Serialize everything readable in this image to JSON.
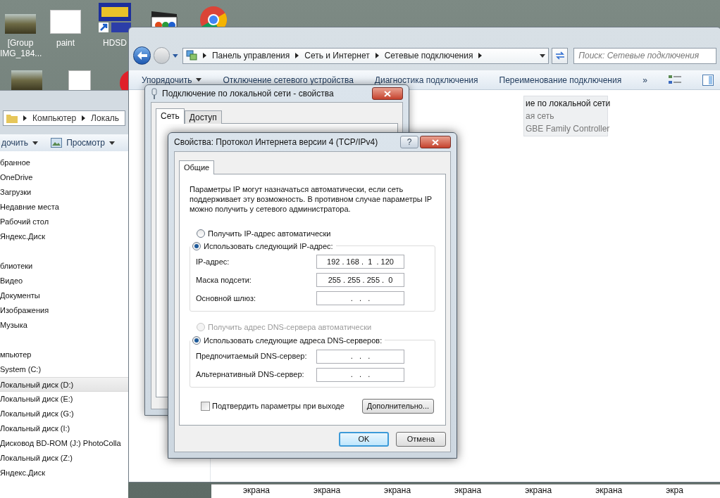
{
  "desktop": {
    "icons": [
      {
        "kind": "photo",
        "label": "[Group IMG_184..."
      },
      {
        "kind": "paint",
        "label": "paint"
      },
      {
        "kind": "shortcut",
        "label": "HDSD"
      },
      {
        "kind": "media"
      },
      {
        "kind": "browser"
      }
    ],
    "icons_row_2": [
      {
        "kind": "photo"
      },
      {
        "kind": "document"
      },
      {
        "kind": "music"
      }
    ]
  },
  "explorer": {
    "breadcrumb": [
      "Компьютер",
      "Локаль"
    ],
    "toolbar": [
      {
        "label": "дочить",
        "dropdown": true,
        "kind": "text"
      },
      {
        "label": "Просмотр",
        "dropdown": true,
        "kind": "view"
      }
    ],
    "nav": [
      {
        "label": "бранное",
        "children": [
          {
            "label": "OneDrive",
            "selected": false
          },
          {
            "label": "Загрузки",
            "selected": false
          },
          {
            "label": "Недавние места",
            "selected": false
          },
          {
            "label": "Рабочий стол",
            "selected": false
          },
          {
            "label": "Яндекс.Диск",
            "selected": false
          }
        ]
      },
      {
        "label": "блиотеки",
        "children": [
          {
            "label": "Видео",
            "selected": false
          },
          {
            "label": "Документы",
            "selected": false
          },
          {
            "label": "Изображения",
            "selected": false
          },
          {
            "label": "Музыка",
            "selected": false
          }
        ]
      },
      {
        "label": "мпьютер",
        "children": [
          {
            "label": "System (C:)",
            "selected": false
          },
          {
            "label": "Локальный диск (D:)",
            "selected": true
          },
          {
            "label": "Локальный диск (E:)",
            "selected": false
          },
          {
            "label": "Локальный диск (G:)",
            "selected": false
          },
          {
            "label": "Локальный диск (I:)",
            "selected": false
          },
          {
            "label": "Дисковод BD-ROM (J:) PhotoColla",
            "selected": false
          },
          {
            "label": "Локальный диск (Z:)",
            "selected": false
          },
          {
            "label": "Яндекс.Диск",
            "selected": false
          }
        ]
      }
    ]
  },
  "network_window": {
    "breadcrumb": [
      "Панель управления",
      "Сеть и Интернет",
      "Сетевые подключения"
    ],
    "search": {
      "placeholder": "Поиск: Сетевые подключения"
    },
    "toolbar": [
      {
        "label": "Упорядочить",
        "dropdown": true
      },
      {
        "label": "Отключение сетевого устройства",
        "dropdown": false
      },
      {
        "label": "Диагностика подключения",
        "dropdown": false
      },
      {
        "label": "Переименование подключения",
        "dropdown": false
      },
      {
        "label": "»",
        "dropdown": false
      }
    ],
    "connection": {
      "name": "ие по локальной сети",
      "status": "ая сеть",
      "device": "GBE Family Controller"
    },
    "bottom_labels": [
      "экрана",
      "экрана",
      "экрана",
      "экрана",
      "экрана",
      "экрана",
      "экра"
    ]
  },
  "connection_dialog": {
    "title": "Подключение по локальной сети - свойства",
    "tabs": [
      {
        "label": "Сеть",
        "selected": true
      },
      {
        "label": "Доступ",
        "selected": false
      }
    ]
  },
  "ipv4_dialog": {
    "title": "Свойства: Протокол Интернета версии 4 (TCP/IPv4)",
    "help": "?",
    "tabs": [
      {
        "label": "Общие",
        "selected": true
      }
    ],
    "description": "Параметры IP могут назначаться автоматически, если сеть поддерживает эту возможность. В противном случае параметры IP можно получить у сетевого администратора.",
    "ip": {
      "auto": {
        "label": "Получить IP-адрес автоматически",
        "selected": false,
        "disabled": false
      },
      "manual": {
        "label": "Использовать следующий IP-адрес:",
        "selected": true,
        "disabled": false
      },
      "fields": [
        {
          "label": "IP-адрес:",
          "value": "192 . 168 .  1  . 120"
        },
        {
          "label": "Маска подсети:",
          "value": "255 . 255 . 255 .  0"
        },
        {
          "label": "Основной шлюз:",
          "value": ".   .   ."
        }
      ]
    },
    "dns": {
      "auto": {
        "label": "Получить адрес DNS-сервера автоматически",
        "selected": false,
        "disabled": true
      },
      "manual": {
        "label": "Использовать следующие адреса DNS-серверов:",
        "selected": true,
        "disabled": false
      },
      "fields": [
        {
          "label": "Предпочитаемый DNS-сервер:",
          "value": ".   .   ."
        },
        {
          "label": "Альтернативный DNS-сервер:",
          "value": ".   .   ."
        }
      ]
    },
    "confirm": {
      "label": "Подтвердить параметры при выходе",
      "checked": false
    },
    "advanced_button": "Дополнительно...",
    "buttons": [
      {
        "label": "OK",
        "default": true
      },
      {
        "label": "Отмена",
        "default": false
      }
    ]
  }
}
